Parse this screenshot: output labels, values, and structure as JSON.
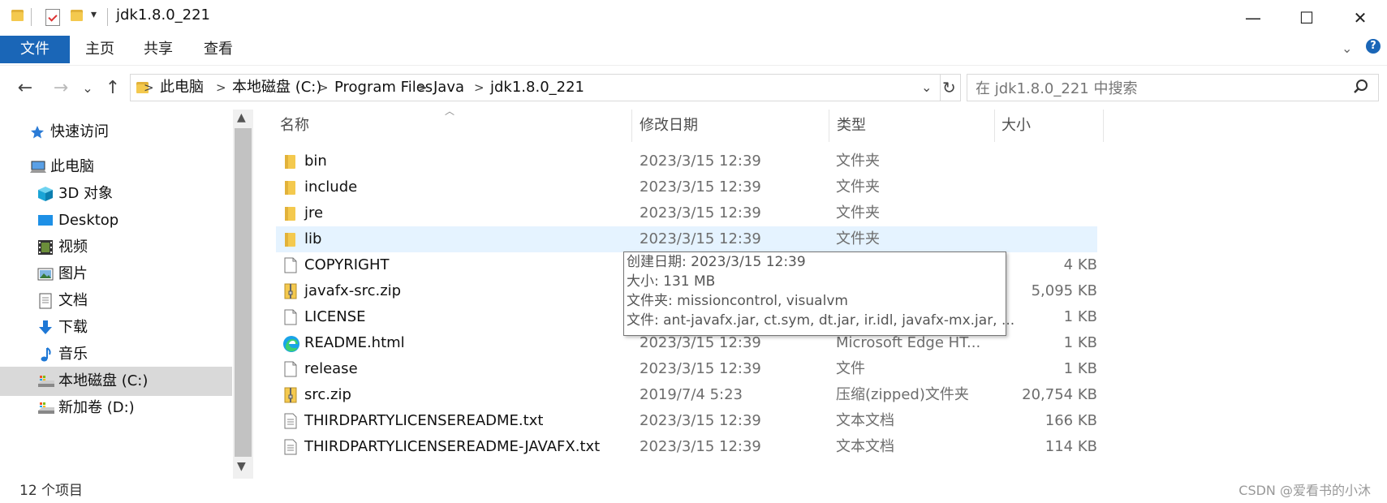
{
  "window": {
    "title": "jdk1.8.0_221",
    "minimize_glyph": "—",
    "maximize_glyph": "☐",
    "close_glyph": "✕"
  },
  "ribbon": {
    "tabs": [
      {
        "label": "文件",
        "active": true
      },
      {
        "label": "主页",
        "active": false
      },
      {
        "label": "共享",
        "active": false
      },
      {
        "label": "查看",
        "active": false
      }
    ]
  },
  "nav_buttons": {
    "back": "←",
    "forward": "→",
    "recent": "⌄",
    "up": "↑",
    "refresh": "↻",
    "dropdown": "⌄"
  },
  "address": {
    "crumbs": [
      "此电脑",
      "本地磁盘 (C:)",
      "Program Files",
      "Java",
      "jdk1.8.0_221"
    ],
    "separator": ">"
  },
  "search": {
    "placeholder": "在 jdk1.8.0_221 中搜索"
  },
  "nav_pane": {
    "items": [
      {
        "label": "快速访问",
        "icon": "star-icon"
      },
      {
        "label": "此电脑",
        "icon": "computer-icon"
      },
      {
        "label": "3D 对象",
        "icon": "cube-icon"
      },
      {
        "label": "Desktop",
        "icon": "desktop-icon"
      },
      {
        "label": "视频",
        "icon": "video-icon"
      },
      {
        "label": "图片",
        "icon": "picture-icon"
      },
      {
        "label": "文档",
        "icon": "document-icon"
      },
      {
        "label": "下载",
        "icon": "download-icon"
      },
      {
        "label": "音乐",
        "icon": "music-icon"
      },
      {
        "label": "本地磁盘 (C:)",
        "icon": "drive-icon",
        "selected": true
      },
      {
        "label": "新加卷 (D:)",
        "icon": "drive-icon"
      }
    ]
  },
  "columns": {
    "name": "名称",
    "date": "修改日期",
    "type": "类型",
    "size": "大小"
  },
  "files": [
    {
      "name": "bin",
      "date": "2023/3/15 12:39",
      "type": "文件夹",
      "size": "",
      "icon": "folder-icon"
    },
    {
      "name": "include",
      "date": "2023/3/15 12:39",
      "type": "文件夹",
      "size": "",
      "icon": "folder-icon"
    },
    {
      "name": "jre",
      "date": "2023/3/15 12:39",
      "type": "文件夹",
      "size": "",
      "icon": "folder-icon"
    },
    {
      "name": "lib",
      "date": "2023/3/15 12:39",
      "type": "文件夹",
      "size": "",
      "icon": "folder-icon",
      "hover": true
    },
    {
      "name": "COPYRIGHT",
      "date": "",
      "type": "",
      "size": "4 KB",
      "icon": "file-icon"
    },
    {
      "name": "javafx-src.zip",
      "date": "",
      "type": "",
      "size": "5,095 KB",
      "icon": "zip-icon"
    },
    {
      "name": "LICENSE",
      "date": "",
      "type": "",
      "size": "1 KB",
      "icon": "file-icon"
    },
    {
      "name": "README.html",
      "date": "2023/3/15 12:39",
      "type": "Microsoft Edge HT...",
      "size": "1 KB",
      "icon": "edge-icon"
    },
    {
      "name": "release",
      "date": "2023/3/15 12:39",
      "type": "文件",
      "size": "1 KB",
      "icon": "file-icon"
    },
    {
      "name": "src.zip",
      "date": "2019/7/4 5:23",
      "type": "压缩(zipped)文件夹",
      "size": "20,754 KB",
      "icon": "zip-icon"
    },
    {
      "name": "THIRDPARTYLICENSEREADME.txt",
      "date": "2023/3/15 12:39",
      "type": "文本文档",
      "size": "166 KB",
      "icon": "text-file-icon"
    },
    {
      "name": "THIRDPARTYLICENSEREADME-JAVAFX.txt",
      "date": "2023/3/15 12:39",
      "type": "文本文档",
      "size": "114 KB",
      "icon": "text-file-icon"
    }
  ],
  "tooltip": {
    "lines": [
      "创建日期: 2023/3/15 12:39",
      "大小: 131 MB",
      "文件夹: missioncontrol, visualvm",
      "文件: ant-javafx.jar, ct.sym, dt.jar, ir.idl, javafx-mx.jar, ..."
    ]
  },
  "status": {
    "item_count": "12 个项目",
    "watermark": "CSDN @爱看书的小沐"
  },
  "colors": {
    "accent": "#1a66b7",
    "hover_row": "#e5f3ff",
    "selected_nav": "#d9d9d9",
    "folder": "#f4c94e"
  }
}
